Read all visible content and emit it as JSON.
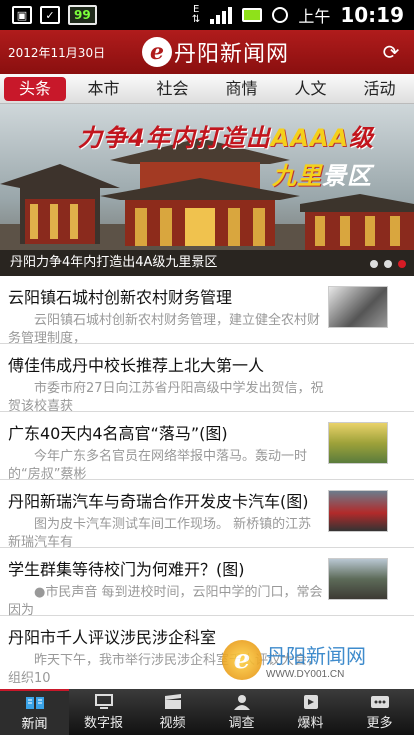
{
  "status_bar": {
    "battery_level": "99",
    "network": "E",
    "ampm": "上午",
    "time": "10:19",
    "icons": [
      "notification-icon",
      "checkbox-icon",
      "battery-saver-icon",
      "signal-icon",
      "battery-icon",
      "alarm-icon"
    ]
  },
  "header": {
    "date": "2012年11月30日",
    "logo_letter": "e",
    "logo_text": "丹阳新闻网",
    "refresh_icon": "refresh-icon"
  },
  "tabs": [
    {
      "label": "头条",
      "active": true
    },
    {
      "label": "本市",
      "active": false
    },
    {
      "label": "社会",
      "active": false
    },
    {
      "label": "商情",
      "active": false
    },
    {
      "label": "人文",
      "active": false
    },
    {
      "label": "活动",
      "active": false
    }
  ],
  "banner": {
    "headline_part1": "力争4年内打造出",
    "headline_highlight": "AAAA",
    "headline_part2": "级",
    "headline_line2": "九里",
    "headline_line2_b": "景区",
    "caption": "丹阳力争4年内打造出4A级九里景区",
    "slide_count": 3,
    "active_slide": 3
  },
  "news": [
    {
      "title": "云阳镇石城村创新农村财务管理",
      "summary": "云阳镇石城村创新农村财务管理，建立健全农村财务管理制度，",
      "has_thumb": true
    },
    {
      "title": "傅佳伟成丹中校长推荐上北大第一人",
      "summary": "市委市府27日向江苏省丹阳高级中学发出贺信，祝贺该校喜获",
      "has_thumb": false
    },
    {
      "title": "广东40天内4名高官“落马”(图)",
      "summary": "今年广东多名官员在网络举报中落马。轰动一时的“房叔”蔡彬",
      "has_thumb": true
    },
    {
      "title": "丹阳新瑞汽车与奇瑞合作开发皮卡汽车(图)",
      "summary": "图为皮卡汽车测试车间工作现场。 新桥镇的江苏新瑞汽车有",
      "has_thumb": true
    },
    {
      "title": "学生群集等待校门为何难开？(图)",
      "summary": "●市民声音 每到进校时间，云阳中学的门口，常会因为",
      "has_thumb": true
    },
    {
      "title": "丹阳市千人评议涉民涉企科室",
      "summary": "昨天下午，我市举行涉民涉企科室千人评议大会，组织10",
      "has_thumb": false
    }
  ],
  "watermark": {
    "letter": "e",
    "name": "丹阳新闻网",
    "url": "WWW.DY001.CN"
  },
  "bottom_nav": [
    {
      "label": "新闻",
      "icon": "news-icon",
      "active": true
    },
    {
      "label": "数字报",
      "icon": "computer-icon",
      "active": false
    },
    {
      "label": "视频",
      "icon": "clapperboard-icon",
      "active": false
    },
    {
      "label": "调查",
      "icon": "people-icon",
      "active": false
    },
    {
      "label": "爆料",
      "icon": "phone-icon",
      "active": false
    },
    {
      "label": "更多",
      "icon": "more-icon",
      "active": false
    }
  ]
}
